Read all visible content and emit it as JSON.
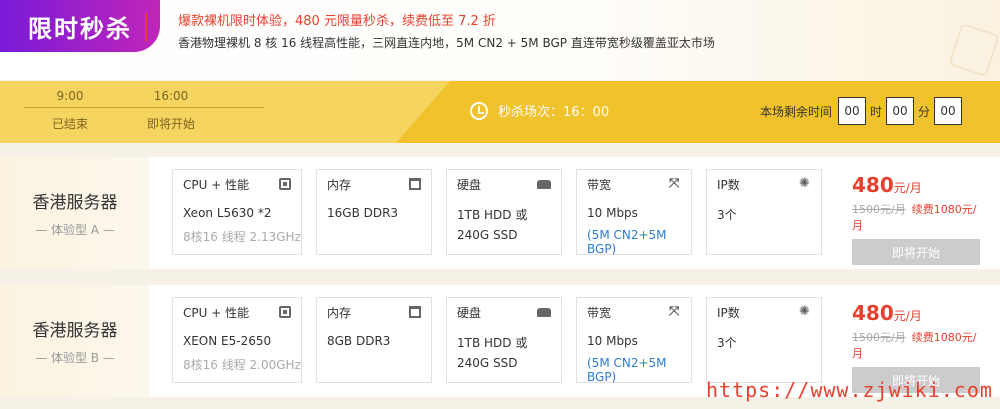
{
  "banner": {
    "tag": "限时秒杀",
    "promo": "爆款裸机限时体验，480 元限量秒杀，续费低至 7.2 折",
    "desc": "香港物理裸机 8 核 16 线程高性能，三网直连内地，5M CN2 + 5M BGP 直连带宽秒级覆盖亚太市场"
  },
  "timeline": [
    {
      "time": "9:00",
      "status": "已结束"
    },
    {
      "time": "16:00",
      "status": "即将开始"
    }
  ],
  "session": {
    "label": "秒杀场次：16：00"
  },
  "countdown": {
    "label": "本场剩余时间",
    "hours": "00",
    "hours_unit": "时",
    "minutes": "00",
    "minutes_unit": "分",
    "seconds": "00"
  },
  "products": [
    {
      "name": "香港服务器",
      "type": "— 体验型 A —",
      "cpu": {
        "label": "CPU + 性能",
        "model": "Xeon L5630 *2",
        "detail": "8核16 线程 2.13GHz"
      },
      "memory": {
        "label": "内存",
        "value": "16GB DDR3"
      },
      "disk": {
        "label": "硬盘",
        "line1": "1TB HDD 或",
        "line2": "240G SSD"
      },
      "bandwidth": {
        "label": "带宽",
        "line1": "10 Mbps",
        "line2": "(5M CN2+5M BGP)"
      },
      "ip": {
        "label": "IP数",
        "value": "3个"
      },
      "price": {
        "amount": "480",
        "unit": "元/月",
        "old": "1500元/月",
        "renew": "续费1080元/月"
      },
      "button": "即将开始"
    },
    {
      "name": "香港服务器",
      "type": "— 体验型 B —",
      "cpu": {
        "label": "CPU + 性能",
        "model": "XEON E5-2650",
        "detail": "8核16 线程 2.00GHz"
      },
      "memory": {
        "label": "内存",
        "value": "8GB DDR3"
      },
      "disk": {
        "label": "硬盘",
        "line1": "1TB HDD 或",
        "line2": "240G SSD"
      },
      "bandwidth": {
        "label": "带宽",
        "line1": "10 Mbps",
        "line2": "(5M CN2+5M BGP)"
      },
      "ip": {
        "label": "IP数",
        "value": "3个"
      },
      "price": {
        "amount": "480",
        "unit": "元/月",
        "old": "1500元/月",
        "renew": "续费1080元/月"
      },
      "button": "即将开始"
    }
  ],
  "watermark": "https://www.zjwiki.com"
}
